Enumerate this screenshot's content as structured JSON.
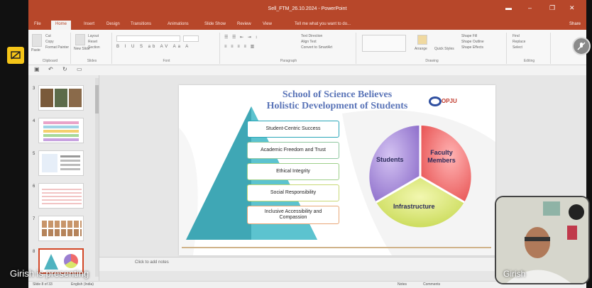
{
  "window": {
    "title": "Sell_FTM_26.10.2024 - PowerPoint",
    "controls": [
      "▬",
      "–",
      "❐",
      "✕"
    ]
  },
  "tabs": [
    "File",
    "Home",
    "Insert",
    "Design",
    "Transitions",
    "Animations",
    "Slide Show",
    "Review",
    "View"
  ],
  "tell_me": "Tell me what you want to do...",
  "share_label": "Share",
  "ribbon": {
    "groups": [
      "Clipboard",
      "Slides",
      "Font",
      "Paragraph",
      "Drawing",
      "Editing"
    ],
    "clipboard_items": [
      "Cut",
      "Copy",
      "Format Painter"
    ],
    "paste_label": "Paste",
    "slides_items": [
      "Layout",
      "Reset",
      "Section"
    ],
    "new_slide_label": "New Slide",
    "paragraph_items": [
      "Text Direction",
      "Align Text",
      "Convert to SmartArt"
    ],
    "drawing_items": [
      "Arrange",
      "Quick Styles",
      "Shape Fill",
      "Shape Outline",
      "Shape Effects"
    ],
    "editing_items": [
      "Find",
      "Replace",
      "Select"
    ]
  },
  "thumbnails": [
    {
      "num": "3"
    },
    {
      "num": "4"
    },
    {
      "num": "5"
    },
    {
      "num": "6"
    },
    {
      "num": "7"
    },
    {
      "num": "8"
    }
  ],
  "slide": {
    "title_line1": "School of Science Believes",
    "title_line2": "Holistic Development of Students",
    "logo_text": "OPJU",
    "pillars": [
      "Student-Centric Success",
      "Academic Freedom and Trust",
      "Ethical Integrity",
      "Social Responsibility",
      "Inclusive Accessibility and Compassion"
    ],
    "cycle": {
      "students": "Students",
      "faculty": "Faculty Members",
      "infrastructure": "Infrastructure"
    }
  },
  "notes_placeholder": "Click to add notes",
  "status": {
    "slide_info": "Slide 8 of 33",
    "language": "English (India)",
    "notes": "Notes",
    "comments": "Comments"
  },
  "meeting": {
    "presenting_label": "Girish is presenting",
    "participant_name": "Girish"
  },
  "colors": {
    "accent": "#b7472a",
    "teal": "#2aa6b8",
    "purple": "#9b7fd1",
    "red": "#f06b6b",
    "yellow": "#d9e66a",
    "badge": "#f5c518"
  }
}
